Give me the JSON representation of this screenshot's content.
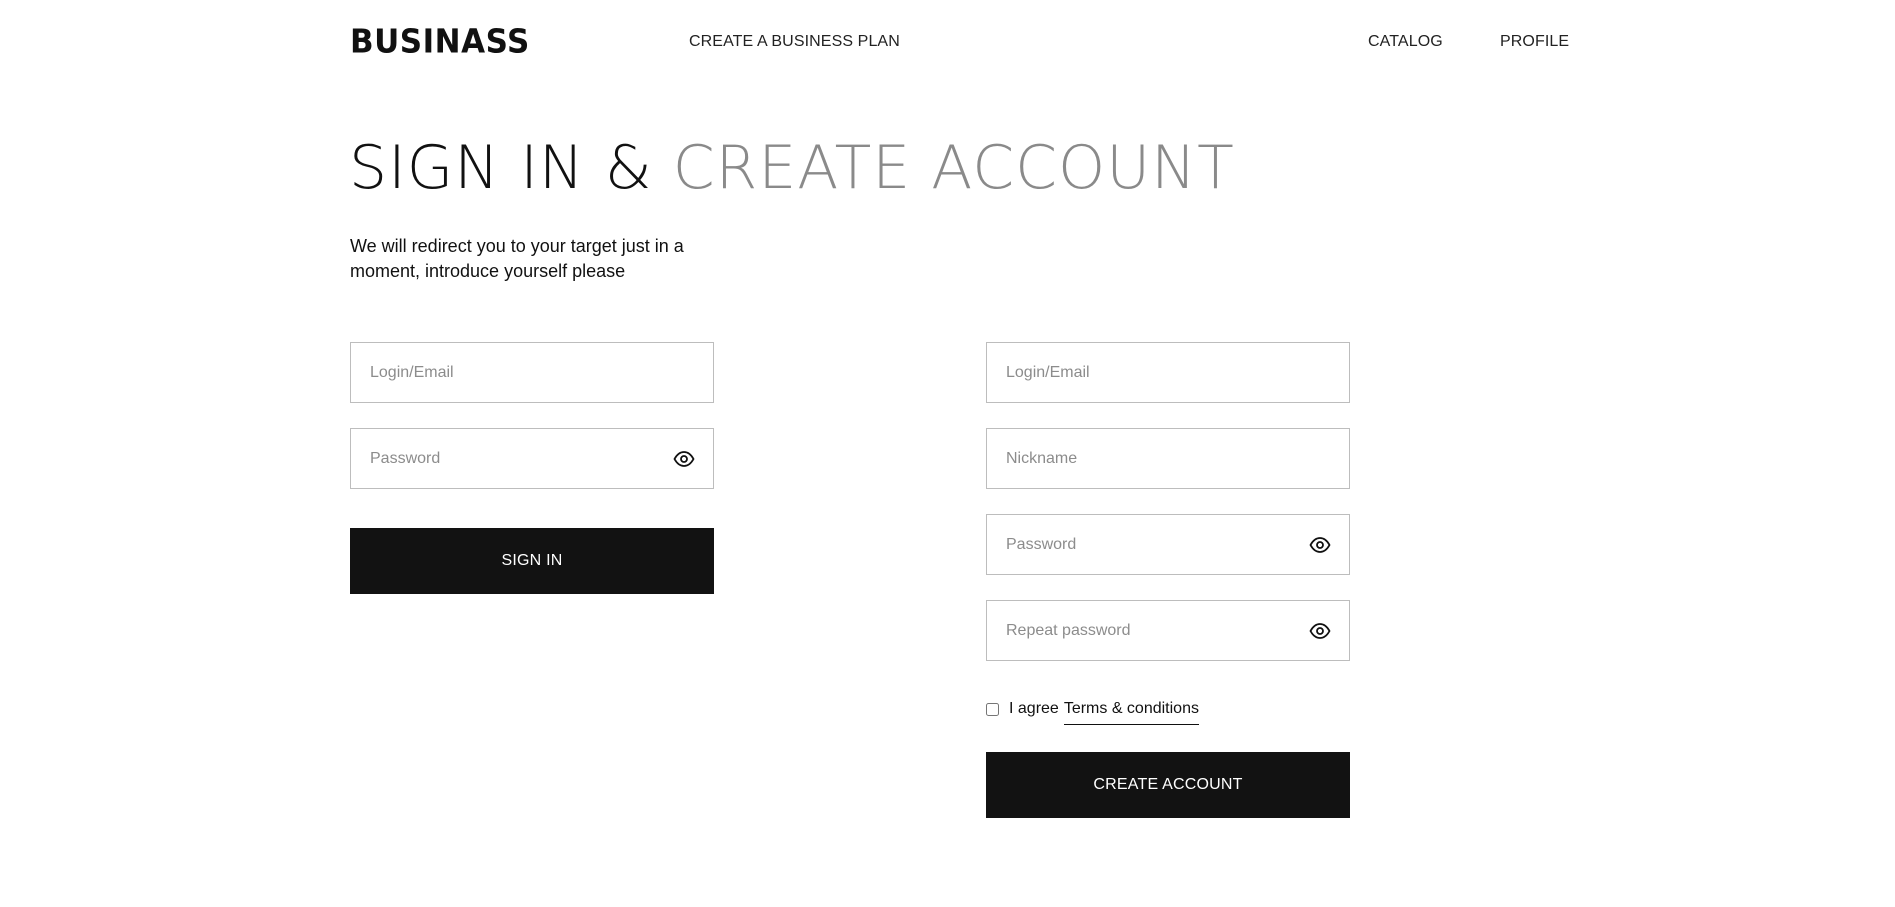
{
  "header": {
    "logo": "BUSINASS",
    "nav": {
      "create_plan": "CREATE A BUSINESS PLAN",
      "catalog": "CATALOG",
      "profile": "PROFILE"
    }
  },
  "title": {
    "part1": "SIGN IN & ",
    "part2": "CREATE ACCOUNT"
  },
  "subtitle": "We will redirect you to your target just in a moment, introduce yourself please",
  "sign_in": {
    "login_placeholder": "Login/Email",
    "password_placeholder": "Password",
    "password_icon": "eye-icon",
    "button_label": "SIGN IN"
  },
  "create_account": {
    "login_placeholder": "Login/Email",
    "nickname_placeholder": "Nickname",
    "password_placeholder": "Password",
    "repeat_password_placeholder": "Repeat password",
    "agree_text": "I agree",
    "terms_link": "Terms & conditions",
    "agree_checked": false,
    "button_label": "CREATE ACCOUNT"
  },
  "colors": {
    "text": "#111111",
    "title_muted": "#8a8a8a",
    "button_bg": "#121212",
    "field_border": "#bdbdbd",
    "placeholder": "#8c8c8c"
  }
}
